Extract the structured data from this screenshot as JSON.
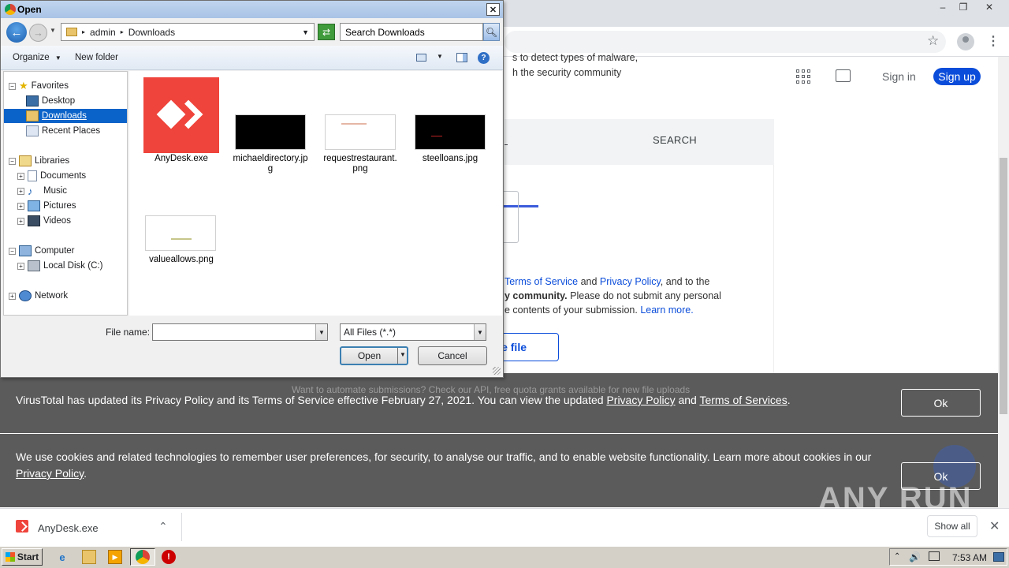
{
  "dialog": {
    "title": "Open",
    "breadcrumb": [
      "admin",
      "Downloads"
    ],
    "search_placeholder": "Search Downloads",
    "toolbar": {
      "organize": "Organize",
      "new_folder": "New folder"
    },
    "tree": {
      "favorites": "Favorites",
      "desktop": "Desktop",
      "downloads": "Downloads",
      "recent": "Recent Places",
      "libraries": "Libraries",
      "documents": "Documents",
      "music": "Music",
      "pictures": "Pictures",
      "videos": "Videos",
      "computer": "Computer",
      "local_disk": "Local Disk (C:)",
      "network": "Network"
    },
    "files": [
      {
        "name": "AnyDesk.exe"
      },
      {
        "name": "michaeldirectory.jp\ng"
      },
      {
        "name": "requestrestaurant.\npng"
      },
      {
        "name": "steelloans.jpg"
      },
      {
        "name": "valueallows.png"
      }
    ],
    "file_name_label": "File name:",
    "file_name_value": "",
    "file_type": "All Files (*.*)",
    "open_label": "Open",
    "cancel_label": "Cancel"
  },
  "page": {
    "intro_line1": "s to detect types of malware,",
    "intro_line2": "h the security community",
    "signin": "Sign in",
    "signup": "Sign up",
    "tab_search": "SEARCH",
    "terms_part1": "Terms of Service",
    "terms_and": "and",
    "terms_part2": "Privacy Policy",
    "terms_tail": ", and to the",
    "community_bold": "y community.",
    "community_rest": " Please do not submit any personal",
    "contents_line": "e contents of your submission. ",
    "learn_more": "Learn more.",
    "choose_file": "e file",
    "api_hint": "Want to automate submissions? Check our API, free quota grants available for new file uploads"
  },
  "privacy_banner": {
    "text": "VirusTotal has updated its Privacy Policy and its Terms of Service effective February 27, 2021. You can view the updated ",
    "link1": "Privacy Policy",
    "and": " and ",
    "link2": "Terms of Services",
    "end": ".",
    "ok": "Ok"
  },
  "cookie_banner": {
    "text": "We use cookies and related technologies to remember user preferences, for security, to analyse our traffic, and to enable website functionality. Learn more about cookies in our ",
    "link": "Privacy Policy",
    "end": ".",
    "ok": "Ok"
  },
  "download_bar": {
    "file": "AnyDesk.exe",
    "show_all": "Show all"
  },
  "taskbar": {
    "start": "Start",
    "time": "7:53 AM"
  },
  "watermark": "ANY RUN",
  "colors": {
    "accent": "#0b4dda",
    "banner": "#5b5b5b",
    "anydesk": "#ef443b"
  }
}
